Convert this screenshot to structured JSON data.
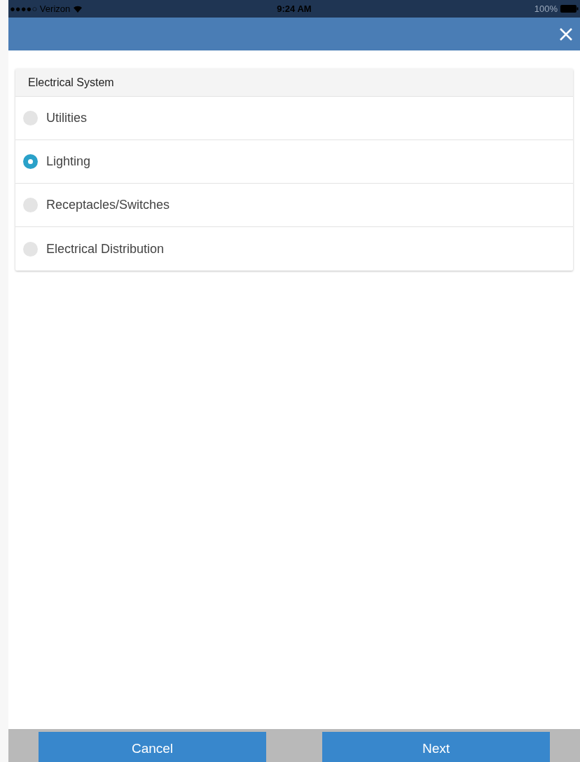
{
  "status_bar": {
    "carrier": "●●●●○ Verizon",
    "time": "9:24 AM",
    "battery": "100%"
  },
  "section": {
    "title": "Electrical System",
    "options": [
      {
        "label": "Utilities",
        "selected": false
      },
      {
        "label": "Lighting",
        "selected": true
      },
      {
        "label": "Receptacles/Switches",
        "selected": false
      },
      {
        "label": "Electrical Distribution",
        "selected": false
      }
    ]
  },
  "buttons": [
    "Cancel",
    "Next"
  ]
}
